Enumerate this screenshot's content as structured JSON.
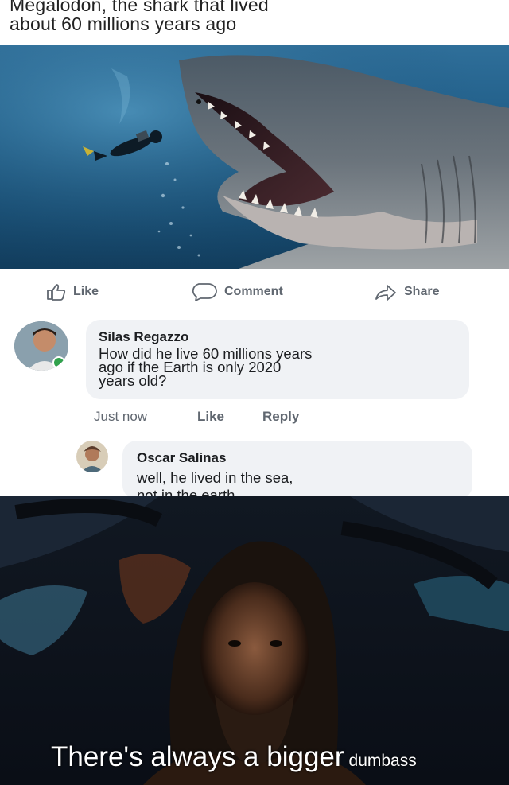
{
  "post": {
    "title_line1": "Megalodon, the shark that lived",
    "title_line2": "about 60 millions years ago"
  },
  "actions": {
    "like": "Like",
    "comment": "Comment",
    "share": "Share"
  },
  "comments": [
    {
      "author": "Silas Regazzo",
      "text_lines": [
        "How did he live 60 millions years",
        "ago if the Earth is only 2020",
        "years old?"
      ],
      "time": "Just now",
      "like": "Like",
      "reply": "Reply"
    },
    {
      "author": "Oscar Salinas",
      "text_lines": [
        "well, he lived in the sea,",
        "not in the earth"
      ]
    }
  ],
  "caption": {
    "main": "There's always a bigger",
    "small": "dumbass"
  },
  "colors": {
    "text_gray": "#606770",
    "bubble": "#f0f2f5",
    "online_dot": "#31a24c"
  }
}
